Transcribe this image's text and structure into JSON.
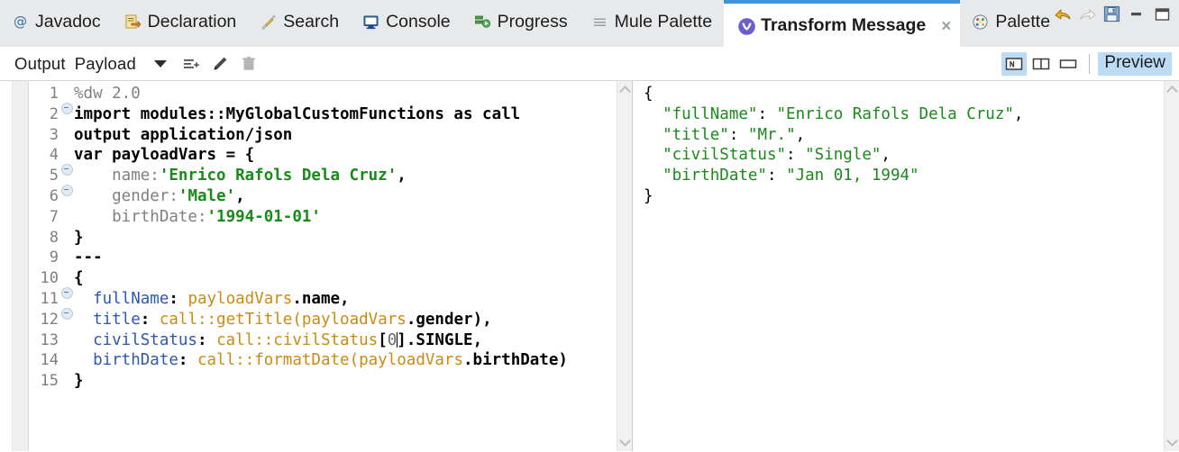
{
  "window": {
    "controls": [
      {
        "name": "undo",
        "icon": "undo-arrow-icon",
        "state": "enabled"
      },
      {
        "name": "redo",
        "icon": "redo-arrow-icon",
        "state": "disabled"
      },
      {
        "name": "save",
        "icon": "save-disk-icon",
        "state": "enabled"
      },
      {
        "name": "minimize",
        "icon": "minimize-icon",
        "state": "enabled"
      },
      {
        "name": "maximize",
        "icon": "maximize-icon",
        "state": "enabled"
      }
    ]
  },
  "tabs": [
    {
      "label": "Javadoc",
      "icon": "at-sign-icon",
      "active": false,
      "closable": false
    },
    {
      "label": "Declaration",
      "icon": "declaration-document-icon",
      "active": false,
      "closable": false
    },
    {
      "label": "Search",
      "icon": "search-icon",
      "active": false,
      "closable": false
    },
    {
      "label": "Console",
      "icon": "console-monitor-icon",
      "active": false,
      "closable": false
    },
    {
      "label": "Progress",
      "icon": "progress-icon",
      "active": false,
      "closable": false
    },
    {
      "label": "Mule Palette",
      "icon": "menu-lines-icon",
      "active": false,
      "closable": false
    },
    {
      "label": "Transform Message",
      "icon": "mule-logo-icon",
      "active": true,
      "closable": true,
      "close_label": "×"
    },
    {
      "label": "Palette",
      "icon": "paint-palette-icon",
      "active": false,
      "closable": false
    }
  ],
  "toolbar": {
    "output_label": "Output",
    "payload_label": "Payload",
    "dropdown_icon": "chevron-down-icon",
    "actions": [
      {
        "name": "add-list-item",
        "icon": "add-list-icon"
      },
      {
        "name": "edit",
        "icon": "pencil-icon"
      },
      {
        "name": "delete",
        "icon": "trash-icon"
      }
    ],
    "layout_buttons": [
      {
        "name": "layout-single",
        "icon": "layout-single-icon",
        "active": true
      },
      {
        "name": "layout-two-column",
        "icon": "layout-two-column-icon",
        "active": false
      },
      {
        "name": "layout-wide",
        "icon": "layout-wide-icon",
        "active": false
      }
    ],
    "preview_label": "Preview",
    "preview_active": true
  },
  "colors": {
    "tabbar_bg": "#e7e9eb",
    "active_tab_accent": "#3f93d6",
    "highlight": "#bcdcf5",
    "string_green": "#1a8a1a",
    "key_blue": "#2b58b5",
    "function_gold": "#cc8a12",
    "gutter_gray": "#808080"
  },
  "editor": {
    "language": "DataWeave",
    "cursor_line": 13,
    "lines": [
      {
        "n": "1",
        "fold": true,
        "tokens": [
          {
            "t": "%dw 2.0",
            "c": "t-dim"
          }
        ]
      },
      {
        "n": "2",
        "fold": false,
        "tokens": [
          {
            "t": "import modules::MyGlobalCustomFunctions as call",
            "c": "t-kw"
          }
        ]
      },
      {
        "n": "3",
        "fold": false,
        "tokens": [
          {
            "t": "output application/json",
            "c": "t-kw"
          }
        ]
      },
      {
        "n": "4",
        "fold": true,
        "tokens": [
          {
            "t": "var payloadVars = {",
            "c": "t-kw"
          }
        ]
      },
      {
        "n": "5",
        "fold": true,
        "tokens": [
          {
            "t": "    name:",
            "c": "t-dim"
          },
          {
            "t": "'Enrico Rafols Dela Cruz'",
            "c": "t-str"
          },
          {
            "t": ",",
            "c": "t-punct"
          }
        ]
      },
      {
        "n": "6",
        "fold": false,
        "tokens": [
          {
            "t": "    gender:",
            "c": "t-dim"
          },
          {
            "t": "'Male'",
            "c": "t-str"
          },
          {
            "t": ",",
            "c": "t-punct"
          }
        ]
      },
      {
        "n": "7",
        "fold": false,
        "tokens": [
          {
            "t": "    birthDate:",
            "c": "t-dim"
          },
          {
            "t": "'1994-01-01'",
            "c": "t-str"
          }
        ]
      },
      {
        "n": "8",
        "fold": false,
        "tokens": [
          {
            "t": "}",
            "c": "t-plain"
          }
        ]
      },
      {
        "n": "9",
        "fold": false,
        "tokens": [
          {
            "t": "---",
            "c": "t-plain"
          }
        ]
      },
      {
        "n": "10",
        "fold": true,
        "tokens": [
          {
            "t": "{",
            "c": "t-plain"
          }
        ]
      },
      {
        "n": "11",
        "fold": true,
        "tokens": [
          {
            "t": "  ",
            "c": "t-plain"
          },
          {
            "t": "fullName",
            "c": "t-key"
          },
          {
            "t": ": ",
            "c": "t-plain"
          },
          {
            "t": "payloadVars",
            "c": "t-fn"
          },
          {
            "t": ".name,",
            "c": "t-plain"
          }
        ]
      },
      {
        "n": "12",
        "fold": false,
        "tokens": [
          {
            "t": "  ",
            "c": "t-plain"
          },
          {
            "t": "title",
            "c": "t-key"
          },
          {
            "t": ": ",
            "c": "t-plain"
          },
          {
            "t": "call::getTitle",
            "c": "t-fn"
          },
          {
            "t": "(",
            "c": "t-fn"
          },
          {
            "t": "payloadVars",
            "c": "t-fn"
          },
          {
            "t": ".gender),",
            "c": "t-plain"
          }
        ]
      },
      {
        "n": "13",
        "fold": false,
        "tokens": [
          {
            "t": "  ",
            "c": "t-plain"
          },
          {
            "t": "civilStatus",
            "c": "t-key"
          },
          {
            "t": ": ",
            "c": "t-plain"
          },
          {
            "t": "call::civilStatus",
            "c": "t-fn"
          },
          {
            "t": "[",
            "c": "t-plain"
          },
          {
            "t": "0",
            "c": "t-num"
          },
          {
            "t": "CURSOR",
            "c": "caret"
          },
          {
            "t": "].SINGLE,",
            "c": "t-plain"
          }
        ]
      },
      {
        "n": "14",
        "fold": false,
        "tokens": [
          {
            "t": "  ",
            "c": "t-plain"
          },
          {
            "t": "birthDate",
            "c": "t-key"
          },
          {
            "t": ": ",
            "c": "t-plain"
          },
          {
            "t": "call::formatDate",
            "c": "t-fn"
          },
          {
            "t": "(",
            "c": "t-fn"
          },
          {
            "t": "payloadVars",
            "c": "t-fn"
          },
          {
            "t": ".birthDate)",
            "c": "t-plain"
          }
        ]
      },
      {
        "n": "15",
        "fold": false,
        "tokens": [
          {
            "t": "}",
            "c": "t-plain"
          }
        ]
      }
    ]
  },
  "preview": {
    "format": "json",
    "lines": [
      [
        {
          "t": "{",
          "c": "j-brace"
        }
      ],
      [
        {
          "t": "  ",
          "c": "j-punct"
        },
        {
          "t": "\"fullName\"",
          "c": "j-str"
        },
        {
          "t": ": ",
          "c": "j-punct"
        },
        {
          "t": "\"Enrico Rafols Dela Cruz\"",
          "c": "j-str"
        },
        {
          "t": ",",
          "c": "j-punct"
        }
      ],
      [
        {
          "t": "  ",
          "c": "j-punct"
        },
        {
          "t": "\"title\"",
          "c": "j-str"
        },
        {
          "t": ": ",
          "c": "j-punct"
        },
        {
          "t": "\"Mr.\"",
          "c": "j-str"
        },
        {
          "t": ",",
          "c": "j-punct"
        }
      ],
      [
        {
          "t": "  ",
          "c": "j-punct"
        },
        {
          "t": "\"civilStatus\"",
          "c": "j-str"
        },
        {
          "t": ": ",
          "c": "j-punct"
        },
        {
          "t": "\"Single\"",
          "c": "j-str"
        },
        {
          "t": ",",
          "c": "j-punct"
        }
      ],
      [
        {
          "t": "  ",
          "c": "j-punct"
        },
        {
          "t": "\"birthDate\"",
          "c": "j-str"
        },
        {
          "t": ": ",
          "c": "j-punct"
        },
        {
          "t": "\"Jan 01, 1994\"",
          "c": "j-str"
        }
      ],
      [
        {
          "t": "}",
          "c": "j-brace"
        }
      ]
    ],
    "values": {
      "fullName": "Enrico Rafols Dela Cruz",
      "title": "Mr.",
      "civilStatus": "Single",
      "birthDate": "Jan 01, 1994"
    }
  }
}
